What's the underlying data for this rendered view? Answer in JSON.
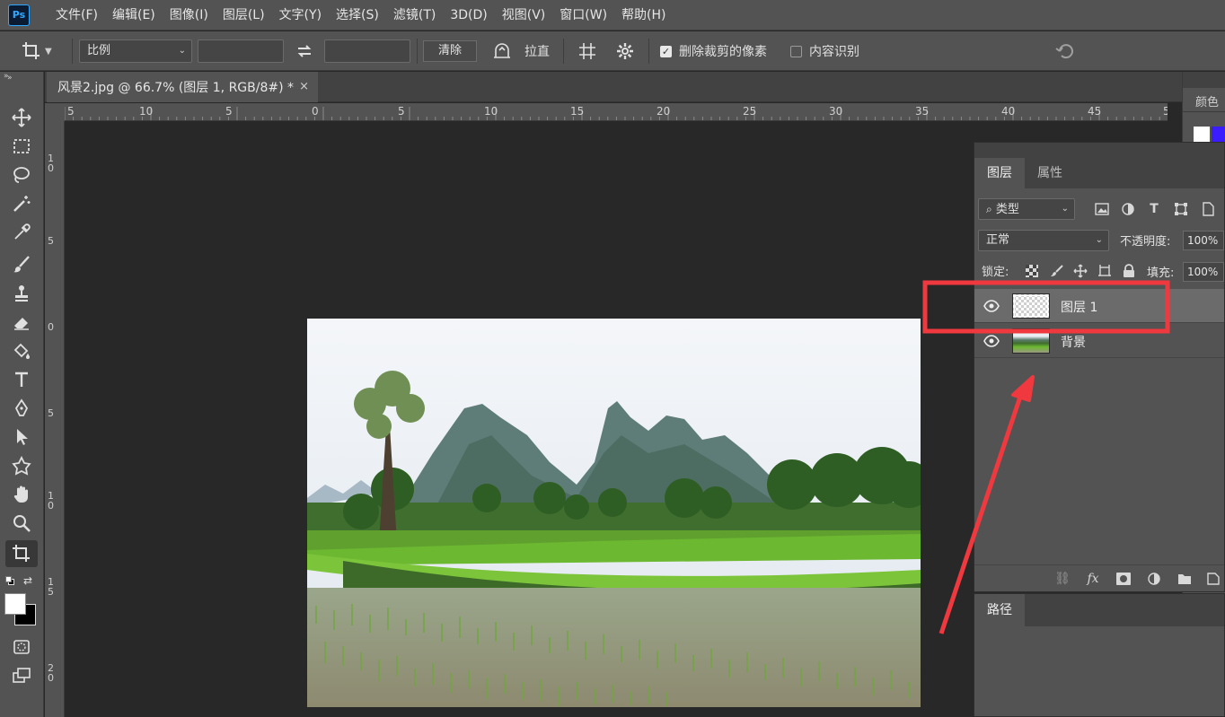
{
  "app": {
    "logo_text": "Ps"
  },
  "menu": [
    "文件(F)",
    "编辑(E)",
    "图像(I)",
    "图层(L)",
    "文字(Y)",
    "选择(S)",
    "滤镜(T)",
    "3D(D)",
    "视图(V)",
    "窗口(W)",
    "帮助(H)"
  ],
  "options": {
    "ratio_select": "比例",
    "clear_label": "清除",
    "straighten_label": "拉直",
    "delete_cropped_label": "删除裁剪的像素",
    "delete_cropped_checked": true,
    "content_aware_label": "内容识别",
    "content_aware_checked": false
  },
  "document": {
    "tab_title": "风景2.jpg @ 66.7% (图层 1, RGB/8#) *",
    "close_glyph": "×"
  },
  "ruler_h": [
    "5",
    "10",
    "5",
    "0",
    "5",
    "10",
    "15",
    "20",
    "25",
    "30",
    "35",
    "40",
    "45",
    "5"
  ],
  "ruler_v": [
    "1\n0",
    "5",
    "0",
    "5",
    "1\n0",
    "1\n5",
    "2\n0"
  ],
  "color_panel": {
    "label": "颜色",
    "fg": "#ffffff",
    "bg": "#3a1cff"
  },
  "layers_panel": {
    "tabs": [
      "图层",
      "属性"
    ],
    "filter_select": "类型",
    "blend_mode": "正常",
    "opacity_label": "不透明度:",
    "opacity_value": "100%",
    "lock_label": "锁定:",
    "fill_label": "填充:",
    "fill_value": "100%",
    "layers": [
      {
        "name": "图层 1",
        "selected": true,
        "thumb": "transparent"
      },
      {
        "name": "背景",
        "selected": false,
        "thumb": "photo"
      }
    ]
  },
  "paths_panel": {
    "tab": "路径"
  },
  "accent": {
    "annotation": "#f0383f",
    "selection": "#6b6b6b"
  }
}
